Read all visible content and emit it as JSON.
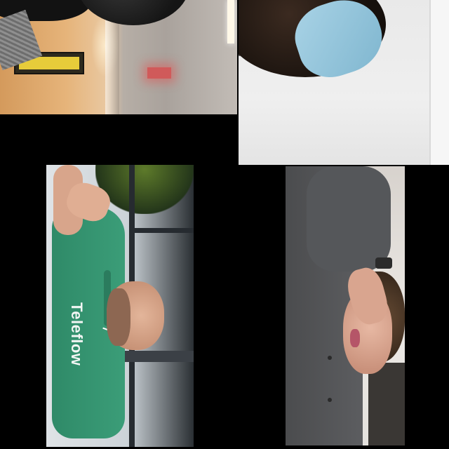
{
  "call": {
    "layout": "grid",
    "tiles": [
      {
        "id": "top-left",
        "scene": "hallway"
      },
      {
        "id": "top-right",
        "scene": "masked-participant"
      },
      {
        "id": "bottom-left",
        "scene": "participant-green-shirt",
        "shirt_text": "Teleflow"
      },
      {
        "id": "bottom-right",
        "scene": "participant-gray-shirt"
      }
    ]
  },
  "colors": {
    "background": "#000000",
    "green_shirt": "#3b9d78",
    "mask_blue": "#a9d3e6",
    "exit_sign": "#d05a5a"
  }
}
